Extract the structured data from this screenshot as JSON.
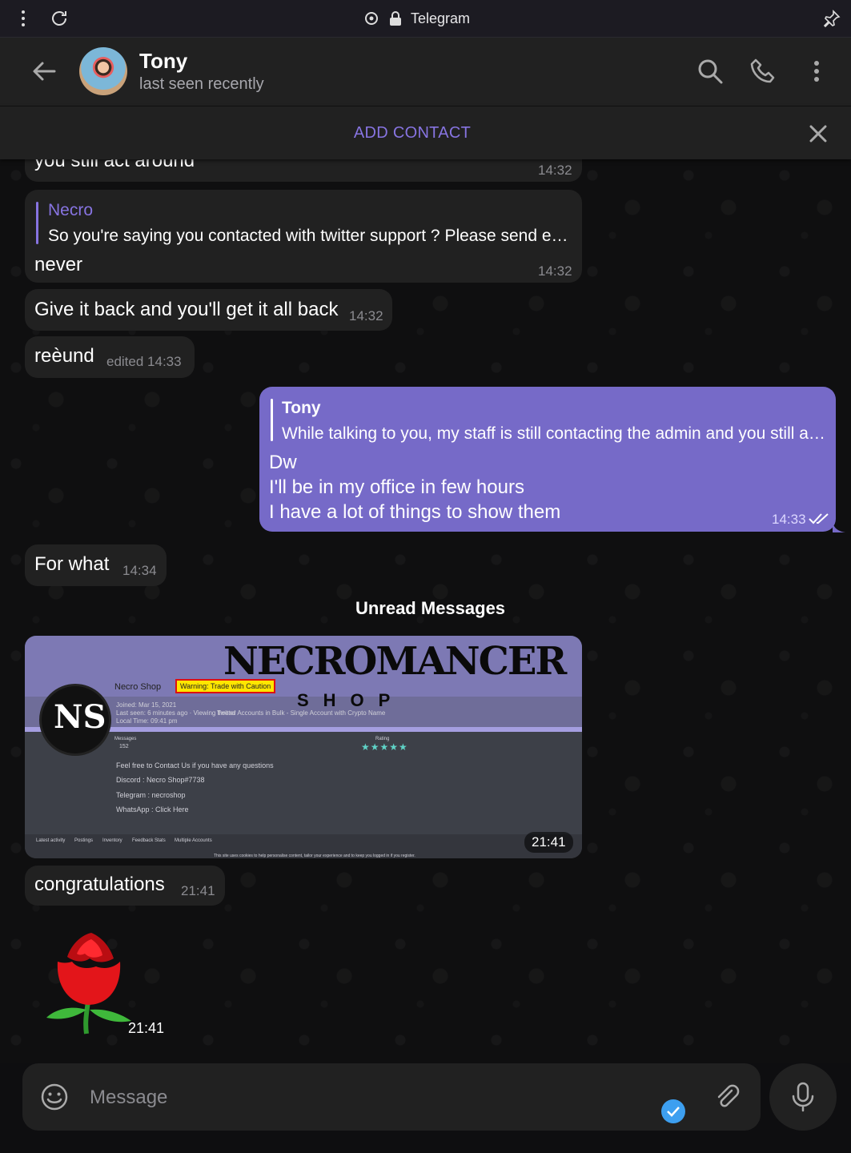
{
  "browser": {
    "title": "Telegram",
    "menu_icon": "more-vertical-icon",
    "reload_icon": "reload-icon",
    "pin_icon": "pin-icon"
  },
  "header": {
    "name": "Tony",
    "status": "last seen recently"
  },
  "add_contact": {
    "label": "ADD CONTACT"
  },
  "messages": [
    {
      "text": "you still act around",
      "time": "14:32"
    },
    {
      "reply_name": "Necro",
      "reply_text": "So you're saying you contacted with twitter support ? Please send e…",
      "text": "never",
      "time": "14:32"
    },
    {
      "text": "Give it back and you'll get it all back",
      "time": "14:32"
    },
    {
      "text": "reèund",
      "time": "edited 14:33"
    },
    {
      "reply_name": "Tony",
      "reply_text": "While talking to you, my staff is still contacting the admin and you still a…",
      "lines": [
        "Dw",
        "I'll be in my office in few hours",
        "I have a lot of things to show them"
      ],
      "time": "14:33"
    },
    {
      "text": "For what",
      "time": "14:34"
    }
  ],
  "unread_label": "Unread Messages",
  "photo": {
    "time": "21:41",
    "brand": "NECROMANCER",
    "shop": "SHOP",
    "logo": "NS",
    "user": "Necro Shop",
    "warning": "Warning: Trade with Caution",
    "joined": "Joined: Mar 15, 2021",
    "last_seen": "Last seen: 6 minutes ago · Viewing thread",
    "thread": "Twitter Accounts in Bulk - Single Account with Crypto Name",
    "local_time": "Local Time: 09:41 pm",
    "messages_label": "Messages",
    "messages_val": "152",
    "rating_label": "Rating",
    "stars": "★★★★★",
    "contact_line": "Feel free to Contact Us if you have any questions",
    "discord": "Discord : Necro Shop#7738",
    "telegram": "Telegram : necroshop",
    "whatsapp": "WhatsApp : Click Here",
    "tabs": [
      "Latest activity",
      "Postings",
      "Inventory",
      "Feedback Stats",
      "Multiple Accounts"
    ],
    "cookie": "This site uses cookies to help personalise content, tailor your experience and to keep you logged in if you register."
  },
  "after_photo": {
    "text": "congratulations",
    "time": "21:41"
  },
  "sticker": {
    "time": "21:41"
  },
  "composer": {
    "placeholder": "Message"
  }
}
